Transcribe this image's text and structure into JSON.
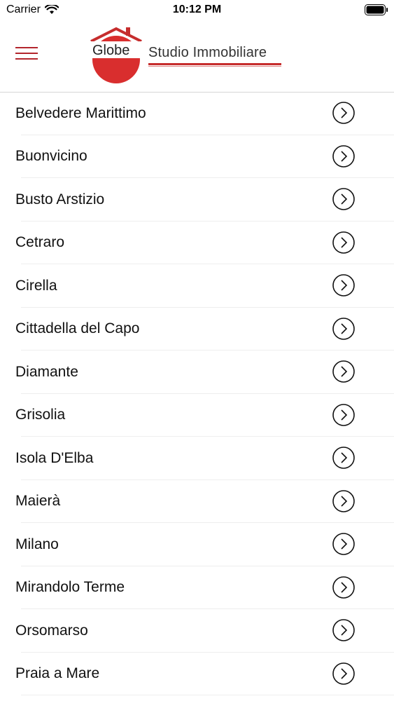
{
  "status_bar": {
    "carrier": "Carrier",
    "time": "10:12 PM"
  },
  "header": {
    "logo_word": "Globe",
    "logo_tagline": "Studio Immobiliare",
    "brand_color": "#c62d2d"
  },
  "icons": {
    "menu": "hamburger-icon",
    "row_action": "chevron-right-circle-icon",
    "wifi": "wifi-icon",
    "battery": "battery-icon"
  },
  "cities": [
    {
      "label": "Belvedere Marittimo"
    },
    {
      "label": "Buonvicino"
    },
    {
      "label": "Busto Arstizio"
    },
    {
      "label": "Cetraro"
    },
    {
      "label": "Cirella"
    },
    {
      "label": "Cittadella del Capo"
    },
    {
      "label": "Diamante"
    },
    {
      "label": "Grisolia"
    },
    {
      "label": "Isola D'Elba"
    },
    {
      "label": "Maierà"
    },
    {
      "label": "Milano"
    },
    {
      "label": "Mirandolo Terme"
    },
    {
      "label": "Orsomarso"
    },
    {
      "label": "Praia a Mare"
    }
  ]
}
